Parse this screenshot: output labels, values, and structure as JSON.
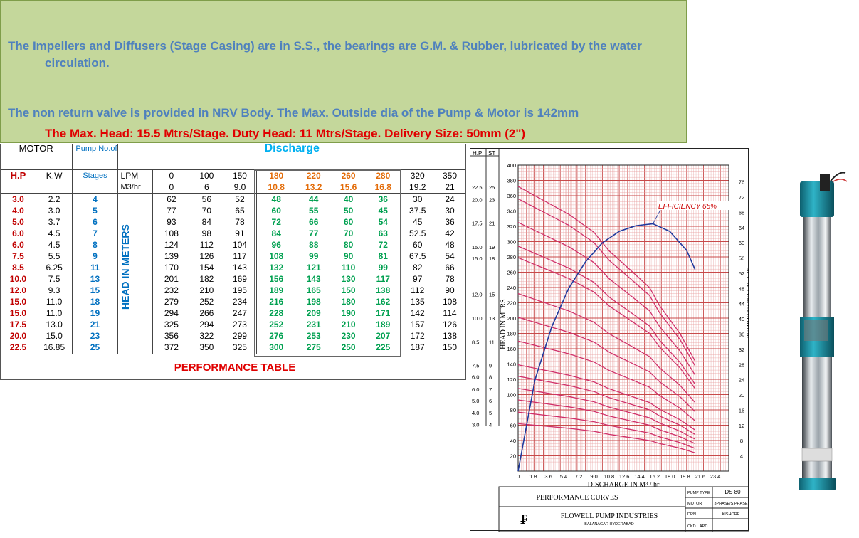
{
  "banner": {
    "line1": "The Impellers and Diffusers (Stage Casing) are in S.S., the bearings are G.M. & Rubber, lubricated by the water",
    "line1b": "circulation.",
    "line2": "The non return valve is provided in NRV Body. The Max. Outside dia of the Pump & Motor is 142mm",
    "line3": "The Max. Head: 15.5 Mtrs/Stage. Duty Head: 11 Mtrs/Stage. Delivery Size: 50mm (2\")"
  },
  "table": {
    "motor_label": "MOTOR",
    "pump_label": "Pump No.of",
    "stages_label": "Stages",
    "discharge_label": "Discharge",
    "hp_label": "H.P",
    "kw_label": "K.W",
    "lpm_label": "LPM",
    "m3_label": "M3/hr",
    "head_label": "HEAD IN METERS",
    "title": "PERFORMANCE TABLE",
    "lpm": [
      "0",
      "100",
      "150",
      "180",
      "220",
      "260",
      "280",
      "320",
      "350"
    ],
    "m3hr": [
      "0",
      "6",
      "9.0",
      "10.8",
      "13.2",
      "15.6",
      "16.8",
      "19.2",
      "21"
    ],
    "rows": [
      {
        "hp": "3.0",
        "kw": "2.2",
        "st": "4",
        "h": [
          "62",
          "56",
          "52",
          "48",
          "44",
          "40",
          "36",
          "30",
          "24"
        ]
      },
      {
        "hp": "4.0",
        "kw": "3.0",
        "st": "5",
        "h": [
          "77",
          "70",
          "65",
          "60",
          "55",
          "50",
          "45",
          "37.5",
          "30"
        ]
      },
      {
        "hp": "5.0",
        "kw": "3.7",
        "st": "6",
        "h": [
          "93",
          "84",
          "78",
          "72",
          "66",
          "60",
          "54",
          "45",
          "36"
        ]
      },
      {
        "hp": "6.0",
        "kw": "4.5",
        "st": "7",
        "h": [
          "108",
          "98",
          "91",
          "84",
          "77",
          "70",
          "63",
          "52.5",
          "42"
        ]
      },
      {
        "hp": "6.0",
        "kw": "4.5",
        "st": "8",
        "h": [
          "124",
          "112",
          "104",
          "96",
          "88",
          "80",
          "72",
          "60",
          "48"
        ]
      },
      {
        "hp": "7.5",
        "kw": "5.5",
        "st": "9",
        "h": [
          "139",
          "126",
          "117",
          "108",
          "99",
          "90",
          "81",
          "67.5",
          "54"
        ]
      },
      {
        "hp": "8.5",
        "kw": "6.25",
        "st": "11",
        "h": [
          "170",
          "154",
          "143",
          "132",
          "121",
          "110",
          "99",
          "82",
          "66"
        ]
      },
      {
        "hp": "10.0",
        "kw": "7.5",
        "st": "13",
        "h": [
          "201",
          "182",
          "169",
          "156",
          "143",
          "130",
          "117",
          "97",
          "78"
        ]
      },
      {
        "hp": "12.0",
        "kw": "9.3",
        "st": "15",
        "h": [
          "232",
          "210",
          "195",
          "189",
          "165",
          "150",
          "138",
          "112",
          "90"
        ]
      },
      {
        "hp": "15.0",
        "kw": "11.0",
        "st": "18",
        "h": [
          "279",
          "252",
          "234",
          "216",
          "198",
          "180",
          "162",
          "135",
          "108"
        ]
      },
      {
        "hp": "15.0",
        "kw": "11.0",
        "st": "19",
        "h": [
          "294",
          "266",
          "247",
          "228",
          "209",
          "190",
          "171",
          "142",
          "114"
        ]
      },
      {
        "hp": "17.5",
        "kw": "13.0",
        "st": "21",
        "h": [
          "325",
          "294",
          "273",
          "252",
          "231",
          "210",
          "189",
          "157",
          "126"
        ]
      },
      {
        "hp": "20.0",
        "kw": "15.0",
        "st": "23",
        "h": [
          "356",
          "322",
          "299",
          "276",
          "253",
          "230",
          "207",
          "172",
          "138"
        ]
      },
      {
        "hp": "22.5",
        "kw": "16.85",
        "st": "25",
        "h": [
          "372",
          "350",
          "325",
          "300",
          "275",
          "250",
          "225",
          "187",
          "150"
        ]
      }
    ]
  },
  "chart_data": {
    "type": "line",
    "title": "",
    "xlabel": "DISCHARGE IN M³ / hr",
    "ylabel": "HEAD IN MTRS",
    "y2label": "PUMP EFFICIENCY IN %",
    "xlim": [
      0,
      25
    ],
    "ylim": [
      0,
      400
    ],
    "y2lim": [
      0,
      78
    ],
    "x_ticks": [
      "0",
      "1.8",
      "3.6",
      "5.4",
      "7.2",
      "9.0",
      "10.8",
      "12.6",
      "14.4",
      "16.2",
      "18.0",
      "19.8",
      "21.6",
      "23.4"
    ],
    "y_ticks": [
      "20",
      "40",
      "60",
      "80",
      "100",
      "120",
      "140",
      "160",
      "180",
      "200",
      "220",
      "240",
      "260",
      "280",
      "300",
      "320",
      "340",
      "360",
      "380",
      "400"
    ],
    "y2_ticks": [
      "4",
      "8",
      "12",
      "16",
      "20",
      "24",
      "28",
      "32",
      "36",
      "40",
      "44",
      "48",
      "52",
      "56",
      "60",
      "64",
      "68",
      "72",
      "76"
    ],
    "annotation": "EFFICIENCY 65%",
    "hp_st_header": [
      "H.P",
      "ST"
    ],
    "hp_st": [
      {
        "hp": "22.5",
        "st": "25",
        "head": 372
      },
      {
        "hp": "20.0",
        "st": "23",
        "head": 356
      },
      {
        "hp": "17.5",
        "st": "21",
        "head": 325
      },
      {
        "hp": "15.0",
        "st": "19",
        "head": 294
      },
      {
        "hp": "15.0",
        "st": "18",
        "head": 279
      },
      {
        "hp": "12.0",
        "st": "15",
        "head": 232
      },
      {
        "hp": "10.0",
        "st": "13",
        "head": 201
      },
      {
        "hp": "8.5",
        "st": "11",
        "head": 170
      },
      {
        "hp": "7.5",
        "st": "9",
        "head": 139
      },
      {
        "hp": "6.0",
        "st": "8",
        "head": 124
      },
      {
        "hp": "6.0",
        "st": "7",
        "head": 108
      },
      {
        "hp": "5.0",
        "st": "6",
        "head": 93
      },
      {
        "hp": "4.0",
        "st": "5",
        "head": 77
      },
      {
        "hp": "3.0",
        "st": "4",
        "head": 62
      }
    ],
    "efficiency_curve": {
      "x": [
        0,
        2,
        4,
        6,
        8,
        10,
        12,
        14,
        16,
        18,
        20,
        21
      ],
      "y": [
        0,
        24,
        38,
        48,
        55,
        60,
        63,
        64.5,
        65,
        63,
        58,
        53
      ]
    },
    "head_curve_shape": {
      "x": [
        0,
        6,
        9,
        10.8,
        13.2,
        15.6,
        16.8,
        19.2,
        21
      ],
      "ratio": [
        1,
        0.903,
        0.839,
        0.774,
        0.71,
        0.645,
        0.581,
        0.484,
        0.387
      ]
    }
  },
  "titleblock": {
    "title": "PERFORMANCE CURVES",
    "pump_type_label": "PUMP TYPE",
    "pump_type": "FDS 80",
    "motor_label": "MOTOR",
    "motor": "3PHASE/S.PHASE",
    "drn_label": "DRN",
    "drn": "KISHORE",
    "ckd_label": "CKD",
    "apd_label": "APD",
    "company": "FLOWELL PUMP INDUSTRIES",
    "address": "BALANAGAR HYDERABAD"
  },
  "colors": {
    "head_curve": "#d0306a",
    "eff_curve": "#1f3a9e",
    "grid_major": "#c84a4a",
    "grid_minor": "#e7a0a0",
    "banner": "#c4d79b"
  }
}
